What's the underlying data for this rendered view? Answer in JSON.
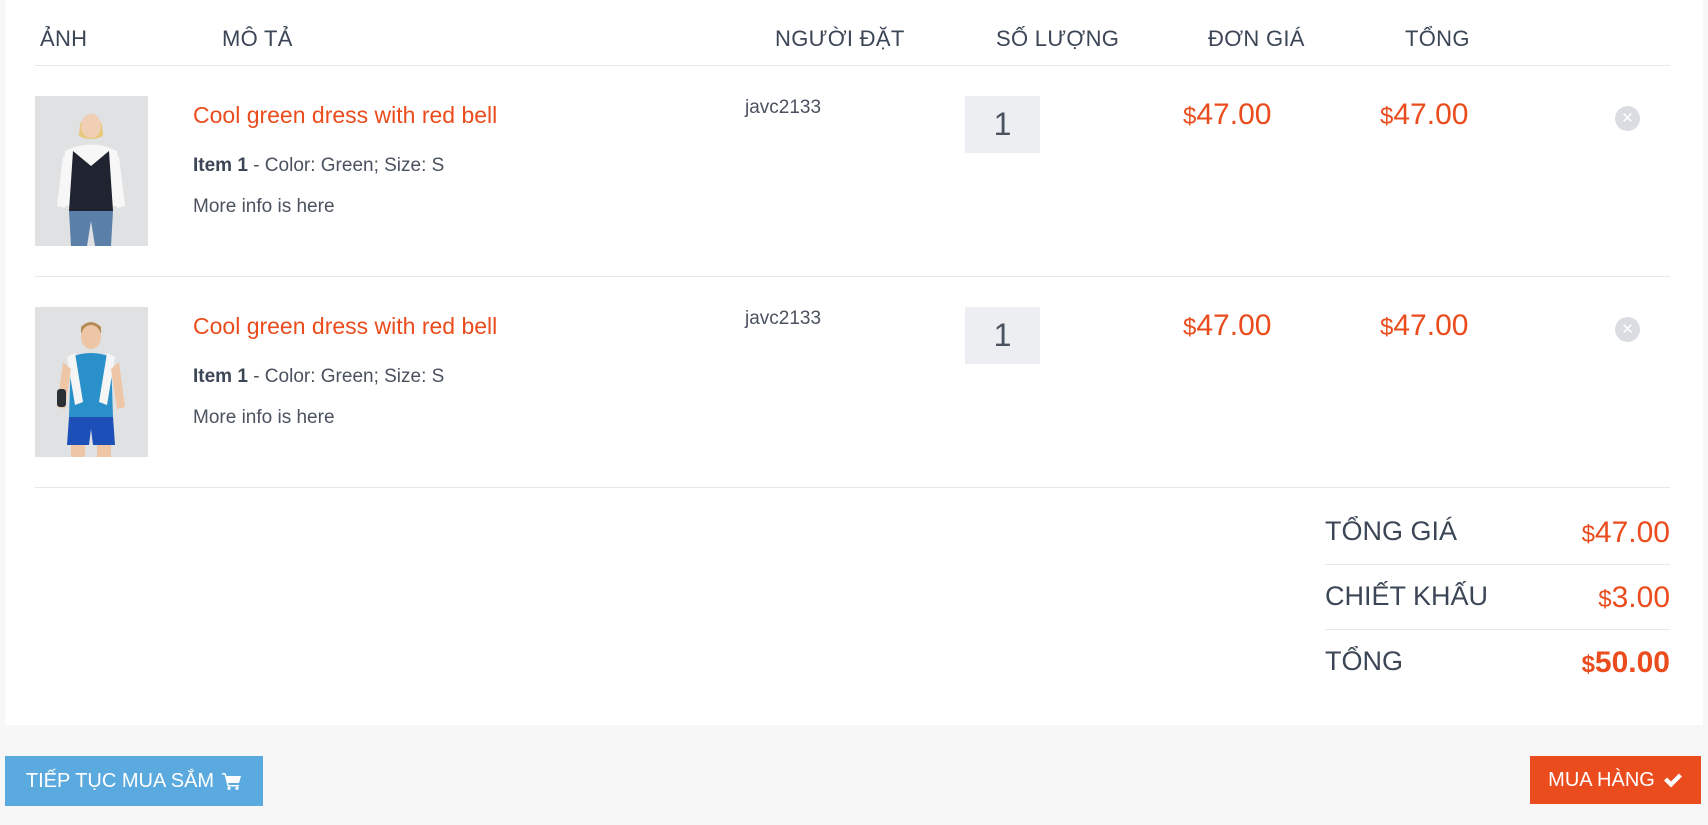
{
  "header": {
    "image": "ẢNH",
    "description": "MÔ TẢ",
    "buyer": "NGƯỜI ĐẶT",
    "quantity": "SỐ LƯỢNG",
    "unit_price": "ĐƠN GIÁ",
    "total": "TỔNG"
  },
  "items": [
    {
      "image_icon": "woman-vest-photo",
      "name": "Cool green dress with red bell",
      "item_label": "Item 1",
      "variant": " - Color: Green; Size: S",
      "more": "More info is here",
      "buyer": "javc2133",
      "quantity": "1",
      "currency": "$",
      "unit_price": "47.00",
      "total": "47.00"
    },
    {
      "image_icon": "man-towel-photo",
      "name": "Cool green dress with red bell",
      "item_label": "Item 1",
      "variant": " - Color: Green; Size: S",
      "more": "More info is here",
      "buyer": "javc2133",
      "quantity": "1",
      "currency": "$",
      "unit_price": "47.00",
      "total": "47.00"
    }
  ],
  "summary": {
    "subtotal_label": "TỔNG GIÁ",
    "subtotal": "47.00",
    "discount_label": "CHIẾT KHẤU",
    "discount": "3.00",
    "total_label": "TỔNG",
    "total": "50.00",
    "currency": "$"
  },
  "actions": {
    "continue_label": "TIẾP TỤC MUA SẮM",
    "continue_icon": "cart-icon",
    "buy_label": "MUA HÀNG",
    "buy_icon": "check-icon"
  },
  "colors": {
    "accent": "#ea4c1d",
    "continue_button": "#5aa9df",
    "text": "#4a5260"
  }
}
